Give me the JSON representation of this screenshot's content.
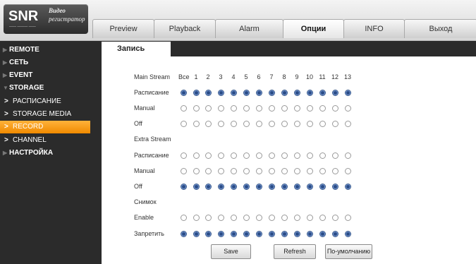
{
  "header": {
    "logo_mark": "SNR",
    "logo_sub": "—— ——— ——",
    "logo_line1": "Видео",
    "logo_line2": "регистратор",
    "tabs": [
      {
        "label": "Preview"
      },
      {
        "label": "Playback"
      },
      {
        "label": "Alarm"
      },
      {
        "label": "Опции",
        "active": true
      },
      {
        "label": "INFO"
      },
      {
        "label": "Выход"
      }
    ]
  },
  "sidebar": {
    "items": [
      {
        "label": "REMOTE"
      },
      {
        "label": "СЕТЬ"
      },
      {
        "label": "EVENT"
      },
      {
        "label": "STORAGE"
      },
      {
        "label": "РАСПИСАНИЕ"
      },
      {
        "label": "STORAGE MEDIA"
      },
      {
        "label": "RECORD",
        "selected": true
      },
      {
        "label": "CHANNEL"
      },
      {
        "label": "НАСТРОЙКА"
      }
    ]
  },
  "content": {
    "tab_label": "Запись",
    "columns": [
      "Все",
      "1",
      "2",
      "3",
      "4",
      "5",
      "6",
      "7",
      "8",
      "9",
      "10",
      "11",
      "12",
      "13"
    ],
    "sections": [
      {
        "title": "Main Stream",
        "rows": [
          {
            "label": "Расписание",
            "checked": true
          },
          {
            "label": "Manual",
            "checked": false
          },
          {
            "label": "Off",
            "checked": false
          }
        ]
      },
      {
        "title": "Extra Stream",
        "rows": [
          {
            "label": "Расписание",
            "checked": false
          },
          {
            "label": "Manual",
            "checked": false
          },
          {
            "label": "Off",
            "checked": true
          }
        ]
      },
      {
        "title": "Снимок",
        "rows": [
          {
            "label": "Enable",
            "checked": false
          },
          {
            "label": "Запретить",
            "checked": true
          }
        ]
      }
    ],
    "buttons": {
      "save": "Save",
      "refresh": "Refresh",
      "default": "По-умолчанию"
    }
  },
  "colors": {
    "accent": "#f59a16",
    "sidebar_bg": "#2b2b2b",
    "radio_on": "#2a4c86"
  }
}
